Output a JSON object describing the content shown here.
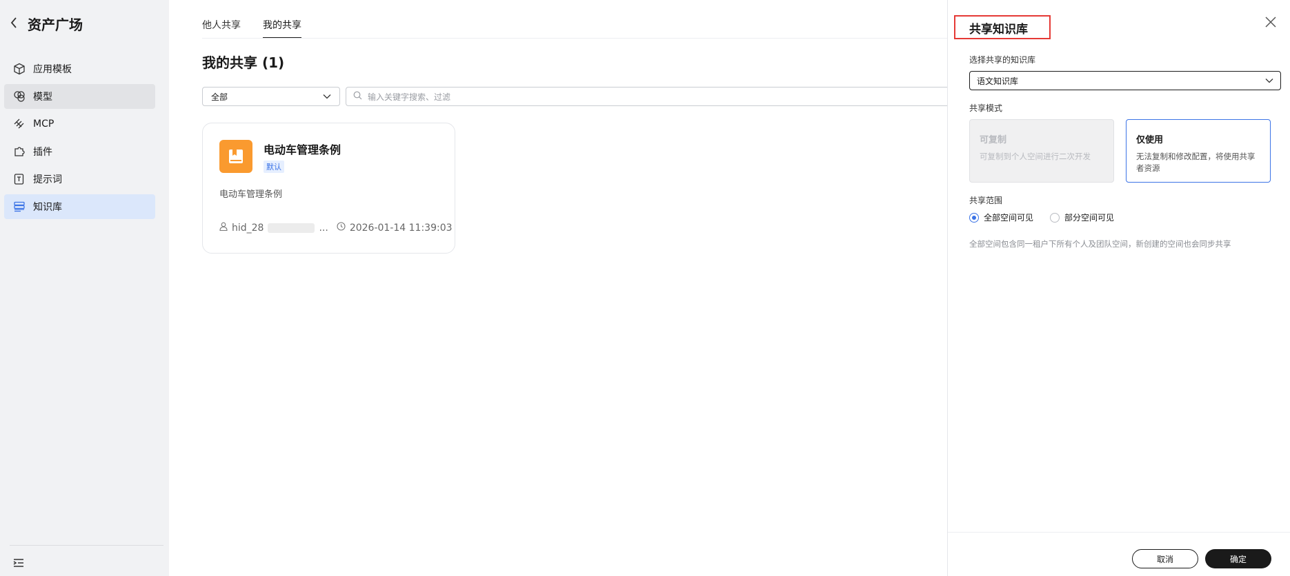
{
  "sidebar": {
    "title": "资产广场",
    "items": [
      {
        "label": "应用模板",
        "icon": "cube-icon"
      },
      {
        "label": "模型",
        "icon": "model-icon"
      },
      {
        "label": "MCP",
        "icon": "mcp-icon"
      },
      {
        "label": "插件",
        "icon": "puzzle-icon"
      },
      {
        "label": "提示词",
        "icon": "prompt-icon"
      },
      {
        "label": "知识库",
        "icon": "database-icon"
      }
    ],
    "active_item": "知识库",
    "hover_item": "模型"
  },
  "main": {
    "tabs": [
      {
        "label": "他人共享"
      },
      {
        "label": "我的共享"
      }
    ],
    "active_tab": "我的共享",
    "page_title": "我的共享 (1)",
    "filter": {
      "value": "全部"
    },
    "search": {
      "placeholder": "输入关键字搜索、过滤"
    },
    "cards": [
      {
        "name": "电动车管理条例",
        "badge": "默认",
        "description": "电动车管理条例",
        "owner_prefix": "hid_28",
        "owner_suffix": "...",
        "date": "2026-01-14 11:39:03"
      }
    ]
  },
  "drawer": {
    "title": "共享知识库",
    "select_label": "选择共享的知识库",
    "select_value": "语文知识库",
    "mode_label": "共享模式",
    "modes": [
      {
        "title": "可复制",
        "desc": "可复制到个人空间进行二次开发",
        "state": "disabled"
      },
      {
        "title": "仅使用",
        "desc": "无法复制和修改配置，将使用共享者资源",
        "state": "selected"
      }
    ],
    "scope_label": "共享范围",
    "scope_options": [
      {
        "label": "全部空间可见",
        "checked": true
      },
      {
        "label": "部分空间可见",
        "checked": false
      }
    ],
    "hint": "全部空间包含同一租户下所有个人及团队空间，新创建的空间也会同步共享",
    "cancel_label": "取消",
    "ok_label": "确定"
  },
  "colors": {
    "accent": "#3b73e6",
    "highlight_box": "#e53935",
    "card_icon": "#fa9a2f"
  }
}
